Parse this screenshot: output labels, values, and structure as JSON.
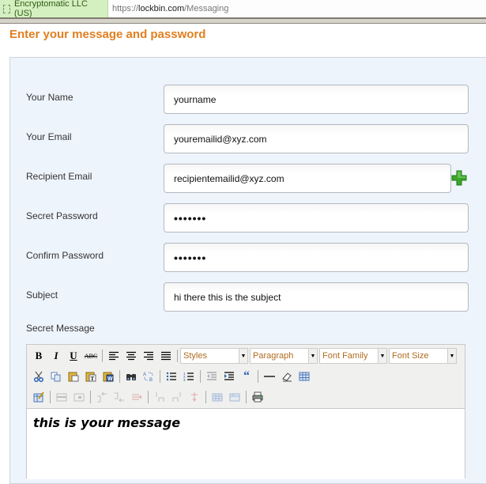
{
  "browser": {
    "cert_label": "Encryptomatic LLC (US)",
    "url_scheme": "https://",
    "url_host": "lockbin.com",
    "url_path": "/Messaging"
  },
  "page": {
    "title": "Enter your message and password"
  },
  "form": {
    "fields": [
      {
        "label": "Your Name",
        "value": "yourname"
      },
      {
        "label": "Your Email",
        "value": "youremailid@xyz.com"
      },
      {
        "label": "Recipient Email",
        "value": "recipientemailid@xyz.com"
      },
      {
        "label": "Secret Password",
        "value": "•••••••"
      },
      {
        "label": "Confirm Password",
        "value": "•••••••"
      },
      {
        "label": "Subject",
        "value": "hi there this is the subject"
      }
    ],
    "add_recipient_icon": "plus-icon",
    "message_label": "Secret Message"
  },
  "editor": {
    "toolbar_row1": {
      "buttons": [
        "B",
        "I",
        "U",
        "ABC"
      ],
      "selects": [
        "Styles",
        "Paragraph",
        "Font Family",
        "Font Size"
      ]
    },
    "toolbar_row2_icons": [
      "cut-icon",
      "copy-icon",
      "paste-icon",
      "paste-text-icon",
      "paste-word-icon",
      "find-icon",
      "replace-icon",
      "bullet-list-icon",
      "numbered-list-icon",
      "outdent-icon",
      "indent-icon",
      "blockquote-icon",
      "horizontal-rule-icon",
      "eraser-icon",
      "table-icon"
    ],
    "toolbar_row3_icons": [
      "table-edit-icon",
      "row-props-icon",
      "cell-props-icon",
      "insert-row-before-icon",
      "insert-row-after-icon",
      "delete-row-icon",
      "insert-col-before-icon",
      "insert-col-after-icon",
      "delete-col-icon",
      "split-cells-icon",
      "merge-cells-icon",
      "print-icon"
    ],
    "content": "this is your message"
  },
  "colors": {
    "title": "#e07f1f",
    "panel_bg": "#eef4fc",
    "select_text": "#b06c1e",
    "add_icon": "#3aa52a"
  }
}
